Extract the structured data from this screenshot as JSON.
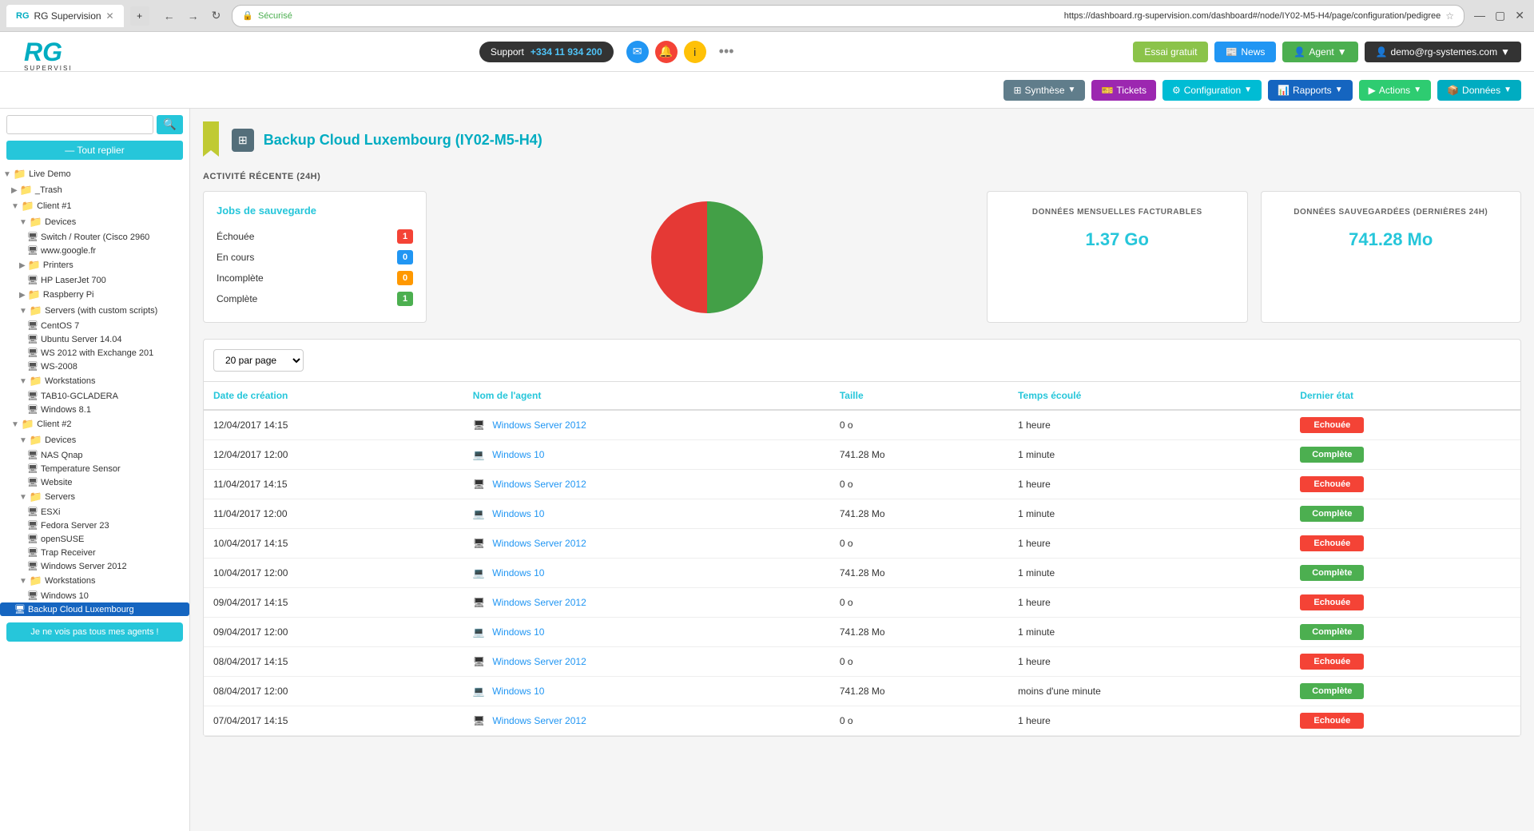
{
  "browser": {
    "tab_title": "RG Supervision",
    "url": "https://dashboard.rg-supervision.com/dashboard#/node/IY02-M5-H4/page/configuration/pedigree",
    "security_label": "Sécurisé"
  },
  "header": {
    "support_label": "Support",
    "support_phone": "+334 11 934 200",
    "news_label": "News",
    "agent_label": "Agent",
    "user_label": "demo@rg-systemes.com",
    "essai_label": "Essai gratuit"
  },
  "toolbar": {
    "synthese_label": "Synthèse",
    "tickets_label": "Tickets",
    "configuration_label": "Configuration",
    "rapports_label": "Rapports",
    "actions_label": "Actions",
    "donnees_label": "Données"
  },
  "sidebar": {
    "search_placeholder": "",
    "reply_btn": "— Tout replier",
    "agent_btn": "Je ne vois pas tous mes agents !",
    "tree": [
      {
        "level": 0,
        "type": "folder",
        "label": "Live Demo",
        "expand": true
      },
      {
        "level": 1,
        "type": "folder",
        "label": "_Trash",
        "red": true
      },
      {
        "level": 1,
        "type": "folder",
        "label": "Client #1",
        "expand": true
      },
      {
        "level": 2,
        "type": "folder",
        "label": "Devices",
        "expand": true
      },
      {
        "level": 3,
        "type": "device",
        "label": "Switch / Router (Cisco 2960"
      },
      {
        "level": 3,
        "type": "device",
        "label": "www.google.fr"
      },
      {
        "level": 2,
        "type": "folder",
        "label": "Printers",
        "red": true
      },
      {
        "level": 3,
        "type": "device",
        "label": "HP LaserJet 700"
      },
      {
        "level": 2,
        "type": "folder",
        "label": "Raspberry Pi"
      },
      {
        "level": 2,
        "type": "folder",
        "label": "Servers (with custom scripts)",
        "expand": true
      },
      {
        "level": 3,
        "type": "device",
        "label": "CentOS 7"
      },
      {
        "level": 3,
        "type": "device",
        "label": "Ubuntu Server 14.04"
      },
      {
        "level": 3,
        "type": "device",
        "label": "WS 2012 with Exchange 201"
      },
      {
        "level": 3,
        "type": "device",
        "label": "WS-2008"
      },
      {
        "level": 2,
        "type": "folder",
        "label": "Workstations",
        "expand": true
      },
      {
        "level": 3,
        "type": "device",
        "label": "TAB10-GCLADERA"
      },
      {
        "level": 3,
        "type": "device",
        "label": "Windows 8.1"
      },
      {
        "level": 1,
        "type": "folder",
        "label": "Client #2",
        "expand": true
      },
      {
        "level": 2,
        "type": "folder",
        "label": "Devices",
        "expand": true
      },
      {
        "level": 3,
        "type": "device",
        "label": "NAS Qnap"
      },
      {
        "level": 3,
        "type": "device",
        "label": "Temperature Sensor"
      },
      {
        "level": 3,
        "type": "device",
        "label": "Website"
      },
      {
        "level": 2,
        "type": "folder",
        "label": "Servers",
        "expand": true
      },
      {
        "level": 3,
        "type": "device",
        "label": "ESXi"
      },
      {
        "level": 3,
        "type": "device",
        "label": "Fedora Server 23"
      },
      {
        "level": 3,
        "type": "device",
        "label": "openSUSE"
      },
      {
        "level": 3,
        "type": "device",
        "label": "Trap Receiver"
      },
      {
        "level": 3,
        "type": "device",
        "label": "Windows Server 2012"
      },
      {
        "level": 2,
        "type": "folder",
        "label": "Workstations",
        "expand": true
      },
      {
        "level": 3,
        "type": "device",
        "label": "Windows 10"
      },
      {
        "level": 1,
        "type": "device",
        "label": "Backup Cloud Luxembourg",
        "active": true
      }
    ]
  },
  "page": {
    "title": "Backup Cloud Luxembourg (IY02-M5-H4)",
    "activity_label": "ACTIVITÉ RÉCENTE (24H)",
    "jobs_title": "Jobs de sauvegarde",
    "jobs": [
      {
        "label": "Échouée",
        "count": "1",
        "badge_type": "red"
      },
      {
        "label": "En cours",
        "count": "0",
        "badge_type": "blue"
      },
      {
        "label": "Incomplète",
        "count": "0",
        "badge_type": "orange"
      },
      {
        "label": "Complète",
        "count": "1",
        "badge_type": "green"
      }
    ],
    "stats": [
      {
        "title": "DONNÉES MENSUELLES FACTURABLES",
        "value": "1.37 Go"
      },
      {
        "title": "DONNÉES SAUVEGARDÉES (DERNIÈRES 24H)",
        "value": "741.28 Mo"
      }
    ],
    "per_page": "20 par page",
    "columns": [
      "Date de création",
      "Nom de l'agent",
      "Taille",
      "Temps écoulé",
      "Dernier état"
    ],
    "rows": [
      {
        "date": "12/04/2017 14:15",
        "icon": "server",
        "agent": "Windows Server 2012",
        "size": "0 o",
        "time": "1 heure",
        "status": "Echouée",
        "status_type": "echouee"
      },
      {
        "date": "12/04/2017 12:00",
        "icon": "desktop",
        "agent": "Windows 10",
        "size": "741.28 Mo",
        "time": "1 minute",
        "status": "Complète",
        "status_type": "complete"
      },
      {
        "date": "11/04/2017 14:15",
        "icon": "server",
        "agent": "Windows Server 2012",
        "size": "0 o",
        "time": "1 heure",
        "status": "Echouée",
        "status_type": "echouee"
      },
      {
        "date": "11/04/2017 12:00",
        "icon": "desktop",
        "agent": "Windows 10",
        "size": "741.28 Mo",
        "time": "1 minute",
        "status": "Complète",
        "status_type": "complete"
      },
      {
        "date": "10/04/2017 14:15",
        "icon": "server",
        "agent": "Windows Server 2012",
        "size": "0 o",
        "time": "1 heure",
        "status": "Echouée",
        "status_type": "echouee"
      },
      {
        "date": "10/04/2017 12:00",
        "icon": "desktop",
        "agent": "Windows 10",
        "size": "741.28 Mo",
        "time": "1 minute",
        "status": "Complète",
        "status_type": "complete"
      },
      {
        "date": "09/04/2017 14:15",
        "icon": "server",
        "agent": "Windows Server 2012",
        "size": "0 o",
        "time": "1 heure",
        "status": "Echouée",
        "status_type": "echouee"
      },
      {
        "date": "09/04/2017 12:00",
        "icon": "desktop",
        "agent": "Windows 10",
        "size": "741.28 Mo",
        "time": "1 minute",
        "status": "Complète",
        "status_type": "complete"
      },
      {
        "date": "08/04/2017 14:15",
        "icon": "server",
        "agent": "Windows Server 2012",
        "size": "0 o",
        "time": "1 heure",
        "status": "Echouée",
        "status_type": "echouee"
      },
      {
        "date": "08/04/2017 12:00",
        "icon": "desktop",
        "agent": "Windows 10",
        "size": "741.28 Mo",
        "time": "moins d'une minute",
        "status": "Complète",
        "status_type": "complete"
      },
      {
        "date": "07/04/2017 14:15",
        "icon": "server",
        "agent": "Windows Server 2012",
        "size": "0 o",
        "time": "1 heure",
        "status": "Echouée",
        "status_type": "echouee"
      }
    ]
  }
}
